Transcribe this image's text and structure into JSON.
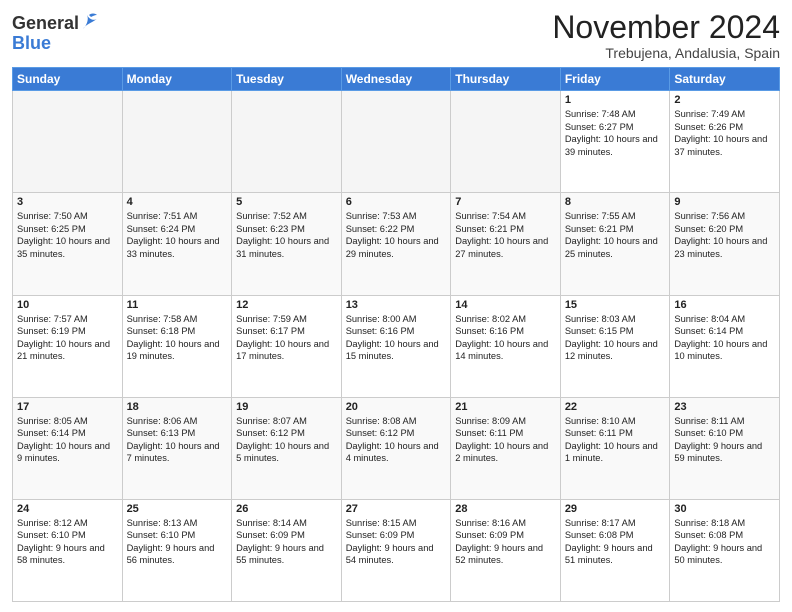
{
  "header": {
    "logo_general": "General",
    "logo_blue": "Blue",
    "month_title": "November 2024",
    "location": "Trebujena, Andalusia, Spain"
  },
  "weekdays": [
    "Sunday",
    "Monday",
    "Tuesday",
    "Wednesday",
    "Thursday",
    "Friday",
    "Saturday"
  ],
  "weeks": [
    [
      {
        "day": "",
        "info": ""
      },
      {
        "day": "",
        "info": ""
      },
      {
        "day": "",
        "info": ""
      },
      {
        "day": "",
        "info": ""
      },
      {
        "day": "",
        "info": ""
      },
      {
        "day": "1",
        "info": "Sunrise: 7:48 AM\nSunset: 6:27 PM\nDaylight: 10 hours and 39 minutes."
      },
      {
        "day": "2",
        "info": "Sunrise: 7:49 AM\nSunset: 6:26 PM\nDaylight: 10 hours and 37 minutes."
      }
    ],
    [
      {
        "day": "3",
        "info": "Sunrise: 7:50 AM\nSunset: 6:25 PM\nDaylight: 10 hours and 35 minutes."
      },
      {
        "day": "4",
        "info": "Sunrise: 7:51 AM\nSunset: 6:24 PM\nDaylight: 10 hours and 33 minutes."
      },
      {
        "day": "5",
        "info": "Sunrise: 7:52 AM\nSunset: 6:23 PM\nDaylight: 10 hours and 31 minutes."
      },
      {
        "day": "6",
        "info": "Sunrise: 7:53 AM\nSunset: 6:22 PM\nDaylight: 10 hours and 29 minutes."
      },
      {
        "day": "7",
        "info": "Sunrise: 7:54 AM\nSunset: 6:21 PM\nDaylight: 10 hours and 27 minutes."
      },
      {
        "day": "8",
        "info": "Sunrise: 7:55 AM\nSunset: 6:21 PM\nDaylight: 10 hours and 25 minutes."
      },
      {
        "day": "9",
        "info": "Sunrise: 7:56 AM\nSunset: 6:20 PM\nDaylight: 10 hours and 23 minutes."
      }
    ],
    [
      {
        "day": "10",
        "info": "Sunrise: 7:57 AM\nSunset: 6:19 PM\nDaylight: 10 hours and 21 minutes."
      },
      {
        "day": "11",
        "info": "Sunrise: 7:58 AM\nSunset: 6:18 PM\nDaylight: 10 hours and 19 minutes."
      },
      {
        "day": "12",
        "info": "Sunrise: 7:59 AM\nSunset: 6:17 PM\nDaylight: 10 hours and 17 minutes."
      },
      {
        "day": "13",
        "info": "Sunrise: 8:00 AM\nSunset: 6:16 PM\nDaylight: 10 hours and 15 minutes."
      },
      {
        "day": "14",
        "info": "Sunrise: 8:02 AM\nSunset: 6:16 PM\nDaylight: 10 hours and 14 minutes."
      },
      {
        "day": "15",
        "info": "Sunrise: 8:03 AM\nSunset: 6:15 PM\nDaylight: 10 hours and 12 minutes."
      },
      {
        "day": "16",
        "info": "Sunrise: 8:04 AM\nSunset: 6:14 PM\nDaylight: 10 hours and 10 minutes."
      }
    ],
    [
      {
        "day": "17",
        "info": "Sunrise: 8:05 AM\nSunset: 6:14 PM\nDaylight: 10 hours and 9 minutes."
      },
      {
        "day": "18",
        "info": "Sunrise: 8:06 AM\nSunset: 6:13 PM\nDaylight: 10 hours and 7 minutes."
      },
      {
        "day": "19",
        "info": "Sunrise: 8:07 AM\nSunset: 6:12 PM\nDaylight: 10 hours and 5 minutes."
      },
      {
        "day": "20",
        "info": "Sunrise: 8:08 AM\nSunset: 6:12 PM\nDaylight: 10 hours and 4 minutes."
      },
      {
        "day": "21",
        "info": "Sunrise: 8:09 AM\nSunset: 6:11 PM\nDaylight: 10 hours and 2 minutes."
      },
      {
        "day": "22",
        "info": "Sunrise: 8:10 AM\nSunset: 6:11 PM\nDaylight: 10 hours and 1 minute."
      },
      {
        "day": "23",
        "info": "Sunrise: 8:11 AM\nSunset: 6:10 PM\nDaylight: 9 hours and 59 minutes."
      }
    ],
    [
      {
        "day": "24",
        "info": "Sunrise: 8:12 AM\nSunset: 6:10 PM\nDaylight: 9 hours and 58 minutes."
      },
      {
        "day": "25",
        "info": "Sunrise: 8:13 AM\nSunset: 6:10 PM\nDaylight: 9 hours and 56 minutes."
      },
      {
        "day": "26",
        "info": "Sunrise: 8:14 AM\nSunset: 6:09 PM\nDaylight: 9 hours and 55 minutes."
      },
      {
        "day": "27",
        "info": "Sunrise: 8:15 AM\nSunset: 6:09 PM\nDaylight: 9 hours and 54 minutes."
      },
      {
        "day": "28",
        "info": "Sunrise: 8:16 AM\nSunset: 6:09 PM\nDaylight: 9 hours and 52 minutes."
      },
      {
        "day": "29",
        "info": "Sunrise: 8:17 AM\nSunset: 6:08 PM\nDaylight: 9 hours and 51 minutes."
      },
      {
        "day": "30",
        "info": "Sunrise: 8:18 AM\nSunset: 6:08 PM\nDaylight: 9 hours and 50 minutes."
      }
    ]
  ]
}
